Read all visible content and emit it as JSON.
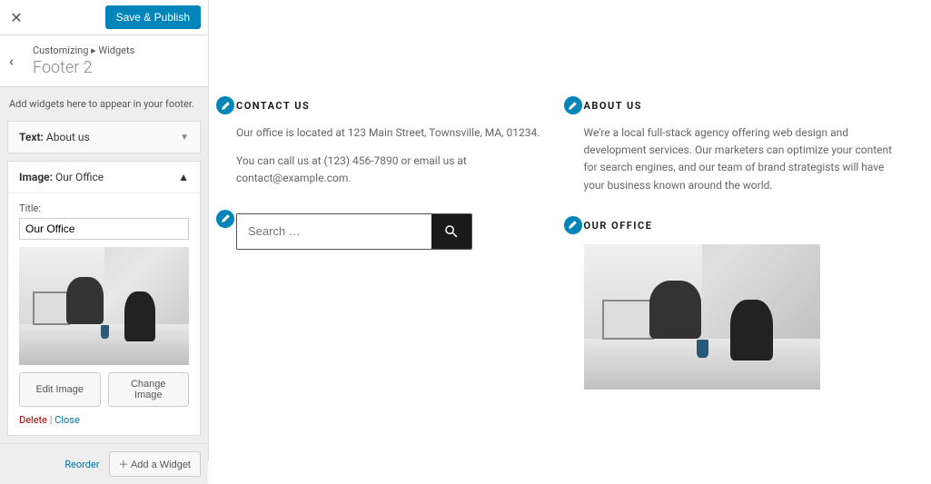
{
  "sidebar": {
    "save_publish": "Save & Publish",
    "breadcrumb": "Customizing ▸ Widgets",
    "section_title": "Footer 2",
    "hint": "Add widgets here to appear in your footer.",
    "widgets": {
      "text_about": {
        "label_prefix": "Text:",
        "label_name": "About us"
      },
      "image_office": {
        "label_prefix": "Image:",
        "label_name": "Our Office",
        "title_label": "Title:",
        "title_value": "Our Office",
        "edit_image": "Edit Image",
        "change_image": "Change Image",
        "delete": "Delete",
        "close": "Close"
      }
    },
    "reorder": "Reorder",
    "add_widget": "Add a Widget"
  },
  "preview": {
    "contact": {
      "title": "CONTACT US",
      "p1": "Our office is located at 123 Main Street, Townsville, MA, 01234.",
      "p2": "You can call us at (123) 456-7890 or email us at contact@example.com."
    },
    "search_placeholder": "Search …",
    "about": {
      "title": "ABOUT US",
      "p1": "We're a local full-stack agency offering web design and development services. Our marketers can optimize your content for search engines, and our team of brand strategists will have your business known around the world."
    },
    "office": {
      "title": "OUR OFFICE"
    }
  }
}
